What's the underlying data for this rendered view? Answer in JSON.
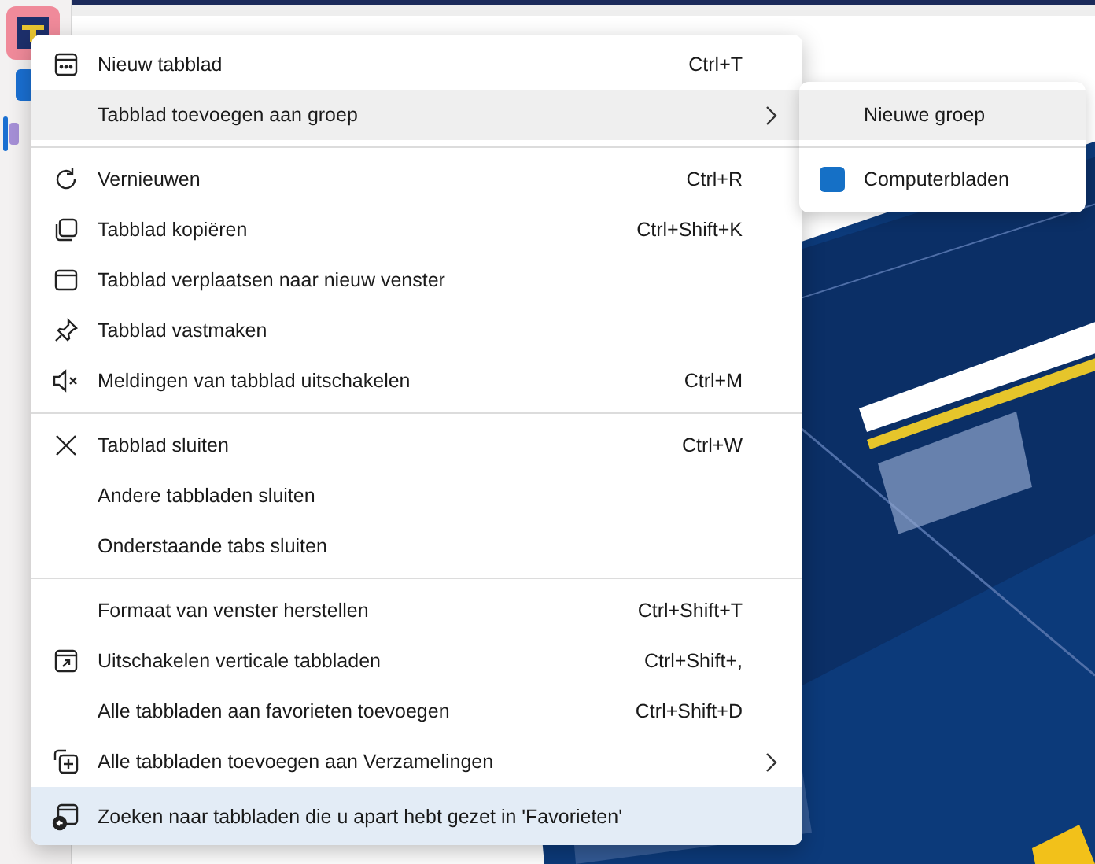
{
  "menu": {
    "sections": [
      [
        {
          "kind": "new-tab",
          "label": "Nieuw tabblad",
          "shortcut": "Ctrl+T",
          "submenu": false,
          "hovered": false,
          "focused": false
        },
        {
          "kind": "plain",
          "label": "Tabblad toevoegen aan groep",
          "submenu": true,
          "hovered": true,
          "focused": false
        }
      ],
      [
        {
          "kind": "refresh",
          "label": "Vernieuwen",
          "shortcut": "Ctrl+R",
          "submenu": false,
          "hovered": false,
          "focused": false
        },
        {
          "kind": "duplicate",
          "label": "Tabblad kopiëren",
          "shortcut": "Ctrl+Shift+K",
          "submenu": false,
          "hovered": false,
          "focused": false
        },
        {
          "kind": "window",
          "label": "Tabblad verplaatsen naar nieuw venster",
          "submenu": false,
          "hovered": false,
          "focused": false
        },
        {
          "kind": "pin",
          "label": "Tabblad vastmaken",
          "submenu": false,
          "hovered": false,
          "focused": false
        },
        {
          "kind": "mute",
          "label": "Meldingen van tabblad uitschakelen",
          "shortcut": "Ctrl+M",
          "submenu": false,
          "hovered": false,
          "focused": false
        }
      ],
      [
        {
          "kind": "close",
          "label": "Tabblad sluiten",
          "shortcut": "Ctrl+W",
          "submenu": false,
          "hovered": false,
          "focused": false
        },
        {
          "kind": "plain",
          "label": "Andere tabbladen sluiten",
          "submenu": false,
          "hovered": false,
          "focused": false
        },
        {
          "kind": "plain",
          "label": "Onderstaande tabs sluiten",
          "submenu": false,
          "hovered": false,
          "focused": false
        }
      ],
      [
        {
          "kind": "plain",
          "label": "Formaat van venster herstellen",
          "shortcut": "Ctrl+Shift+T",
          "submenu": false,
          "hovered": false,
          "focused": false
        },
        {
          "kind": "vertical-tabs",
          "label": "Uitschakelen verticale tabbladen",
          "shortcut": "Ctrl+Shift+,",
          "submenu": false,
          "hovered": false,
          "focused": false
        },
        {
          "kind": "plain",
          "label": "Alle tabbladen aan favorieten toevoegen",
          "shortcut": "Ctrl+Shift+D",
          "submenu": false,
          "hovered": false,
          "focused": false
        },
        {
          "kind": "collections",
          "label": "Alle tabbladen toevoegen aan Verzamelingen",
          "submenu": true,
          "hovered": false,
          "focused": false
        },
        {
          "kind": "search-tabs",
          "label": "Zoeken naar tabbladen die u apart hebt gezet in 'Favorieten'",
          "submenu": false,
          "hovered": false,
          "focused": true
        }
      ]
    ]
  },
  "submenu": {
    "sections": [
      [
        {
          "label": "Nieuwe groep",
          "hovered": true
        }
      ],
      [
        {
          "label": "Computerbladen",
          "color": "#1570c6",
          "hovered": false
        }
      ]
    ]
  }
}
